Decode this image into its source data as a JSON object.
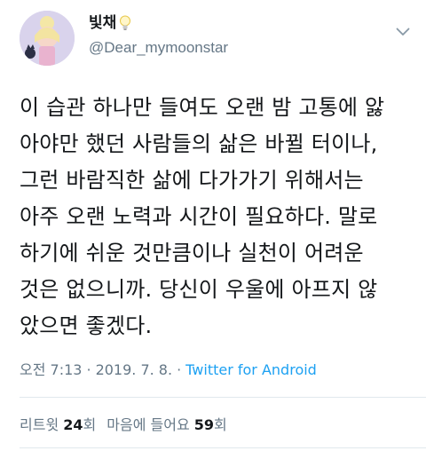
{
  "user": {
    "display_name": "빛채",
    "handle": "@Dear_mymoonstar"
  },
  "tweet": {
    "text": "이 습관 하나만 들여도 오랜 밤 고통에 앓\n아야만 했던 사람들의 삶은 바뀔 터이나,\n그런 바람직한 삶에 다가가기 위해서는\n아주 오랜 노력과 시간이 필요하다. 말로\n하기에 쉬운 것만큼이나 실천이 어려운\n것은 없으니까. 당신이 우울에 아프지 않\n았으면 좋겠다."
  },
  "meta": {
    "time": "오전 7:13",
    "separator": "·",
    "date": "2019. 7. 8.",
    "separator2": "·",
    "source": "Twitter for Android"
  },
  "stats": {
    "retweets_label": "리트윗",
    "retweets_count": "24",
    "retweets_unit": "회",
    "likes_label": "마음에 들어요",
    "likes_count": "59",
    "likes_unit": "회"
  },
  "icons": {
    "name_emoji": "lightbulb-icon",
    "menu": "chevron-down-icon"
  },
  "colors": {
    "text_primary": "#14171a",
    "text_secondary": "#657786",
    "link": "#1da1f2",
    "divider": "#e1e8ed"
  }
}
